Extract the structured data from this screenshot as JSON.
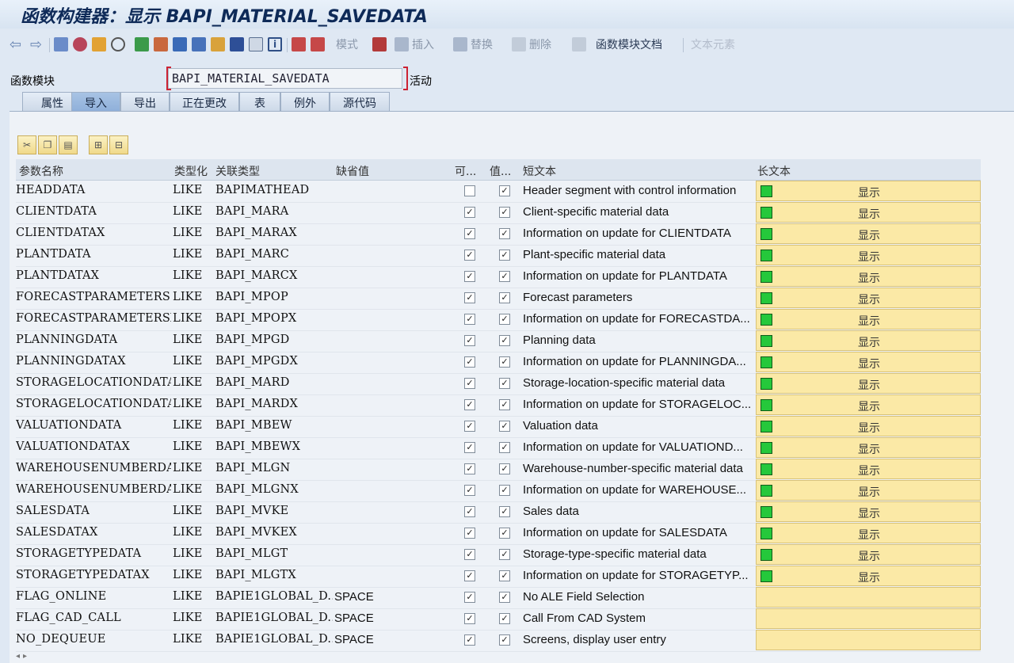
{
  "title": "函数构建器：显示 BAPI_MATERIAL_SAVEDATA",
  "toolbar": {
    "mode_label": "模式",
    "insert_label": "插入",
    "replace_label": "替换",
    "delete_label": "删除",
    "doc_label": "函数模块文档",
    "text_elements_label": "文本元素"
  },
  "function_module": {
    "label": "函数模块",
    "value": "BAPI_MATERIAL_SAVEDATA",
    "status": "活动"
  },
  "tabs": [
    "属性",
    "导入",
    "导出",
    "正在更改",
    "表",
    "例外",
    "源代码"
  ],
  "active_tab": "导入",
  "columns": {
    "param": "参数名称",
    "typing": "类型化",
    "assoc_type": "关联类型",
    "default": "缺省值",
    "optional": "可...",
    "pass_value": "值...",
    "short_text": "短文本",
    "long_text": "长文本"
  },
  "display_label": "显示",
  "rows": [
    {
      "param": "HEADDATA",
      "typing": "LIKE",
      "assoc": "BAPIMATHEAD",
      "default": "",
      "optional": "",
      "value": "✓",
      "short": "Header segment with control information",
      "has_long": true
    },
    {
      "param": "CLIENTDATA",
      "typing": "LIKE",
      "assoc": "BAPI_MARA",
      "default": "",
      "optional": "✓",
      "value": "✓",
      "short": "Client-specific material data",
      "has_long": true
    },
    {
      "param": "CLIENTDATAX",
      "typing": "LIKE",
      "assoc": "BAPI_MARAX",
      "default": "",
      "optional": "✓",
      "value": "✓",
      "short": "Information on update for CLIENTDATA",
      "has_long": true
    },
    {
      "param": "PLANTDATA",
      "typing": "LIKE",
      "assoc": "BAPI_MARC",
      "default": "",
      "optional": "✓",
      "value": "✓",
      "short": "Plant-specific material data",
      "has_long": true
    },
    {
      "param": "PLANTDATAX",
      "typing": "LIKE",
      "assoc": "BAPI_MARCX",
      "default": "",
      "optional": "✓",
      "value": "✓",
      "short": "Information on update for PLANTDATA",
      "has_long": true
    },
    {
      "param": "FORECASTPARAMETERS",
      "typing": "LIKE",
      "assoc": "BAPI_MPOP",
      "default": "",
      "optional": "✓",
      "value": "✓",
      "short": "Forecast parameters",
      "has_long": true
    },
    {
      "param": "FORECASTPARAMETERSX",
      "typing": "LIKE",
      "assoc": "BAPI_MPOPX",
      "default": "",
      "optional": "✓",
      "value": "✓",
      "short": "Information on update for FORECASTDA...",
      "has_long": true
    },
    {
      "param": "PLANNINGDATA",
      "typing": "LIKE",
      "assoc": "BAPI_MPGD",
      "default": "",
      "optional": "✓",
      "value": "✓",
      "short": "Planning data",
      "has_long": true
    },
    {
      "param": "PLANNINGDATAX",
      "typing": "LIKE",
      "assoc": "BAPI_MPGDX",
      "default": "",
      "optional": "✓",
      "value": "✓",
      "short": "Information on update for PLANNINGDA...",
      "has_long": true
    },
    {
      "param": "STORAGELOCATIONDATA",
      "typing": "LIKE",
      "assoc": "BAPI_MARD",
      "default": "",
      "optional": "✓",
      "value": "✓",
      "short": "Storage-location-specific material data",
      "has_long": true
    },
    {
      "param": "STORAGELOCATIONDATAX",
      "typing": "LIKE",
      "assoc": "BAPI_MARDX",
      "default": "",
      "optional": "✓",
      "value": "✓",
      "short": "Information on update for STORAGELOC...",
      "has_long": true
    },
    {
      "param": "VALUATIONDATA",
      "typing": "LIKE",
      "assoc": "BAPI_MBEW",
      "default": "",
      "optional": "✓",
      "value": "✓",
      "short": "Valuation data",
      "has_long": true
    },
    {
      "param": "VALUATIONDATAX",
      "typing": "LIKE",
      "assoc": "BAPI_MBEWX",
      "default": "",
      "optional": "✓",
      "value": "✓",
      "short": "Information on update for VALUATIOND...",
      "has_long": true
    },
    {
      "param": "WAREHOUSENUMBERDATA",
      "typing": "LIKE",
      "assoc": "BAPI_MLGN",
      "default": "",
      "optional": "✓",
      "value": "✓",
      "short": "Warehouse-number-specific material data",
      "has_long": true
    },
    {
      "param": "WAREHOUSENUMBERDATAX",
      "typing": "LIKE",
      "assoc": "BAPI_MLGNX",
      "default": "",
      "optional": "✓",
      "value": "✓",
      "short": "Information on update for WAREHOUSE...",
      "has_long": true
    },
    {
      "param": "SALESDATA",
      "typing": "LIKE",
      "assoc": "BAPI_MVKE",
      "default": "",
      "optional": "✓",
      "value": "✓",
      "short": "Sales data",
      "has_long": true
    },
    {
      "param": "SALESDATAX",
      "typing": "LIKE",
      "assoc": "BAPI_MVKEX",
      "default": "",
      "optional": "✓",
      "value": "✓",
      "short": "Information on update for SALESDATA",
      "has_long": true
    },
    {
      "param": "STORAGETYPEDATA",
      "typing": "LIKE",
      "assoc": "BAPI_MLGT",
      "default": "",
      "optional": "✓",
      "value": "✓",
      "short": "Storage-type-specific material data",
      "has_long": true
    },
    {
      "param": "STORAGETYPEDATAX",
      "typing": "LIKE",
      "assoc": "BAPI_MLGTX",
      "default": "",
      "optional": "✓",
      "value": "✓",
      "short": "Information on update for STORAGETYP...",
      "has_long": true
    },
    {
      "param": "FLAG_ONLINE",
      "typing": "LIKE",
      "assoc": "BAPIE1GLOBAL_D...",
      "default": "SPACE",
      "optional": "✓",
      "value": "✓",
      "short": "No ALE Field Selection",
      "has_long": false
    },
    {
      "param": "FLAG_CAD_CALL",
      "typing": "LIKE",
      "assoc": "BAPIE1GLOBAL_D...",
      "default": "SPACE",
      "optional": "✓",
      "value": "✓",
      "short": "Call From CAD System",
      "has_long": false
    },
    {
      "param": "NO_DEQUEUE",
      "typing": "LIKE",
      "assoc": "BAPIE1GLOBAL_D...",
      "default": "SPACE",
      "optional": "✓",
      "value": "✓",
      "short": "Screens, display user entry",
      "has_long": false
    }
  ]
}
